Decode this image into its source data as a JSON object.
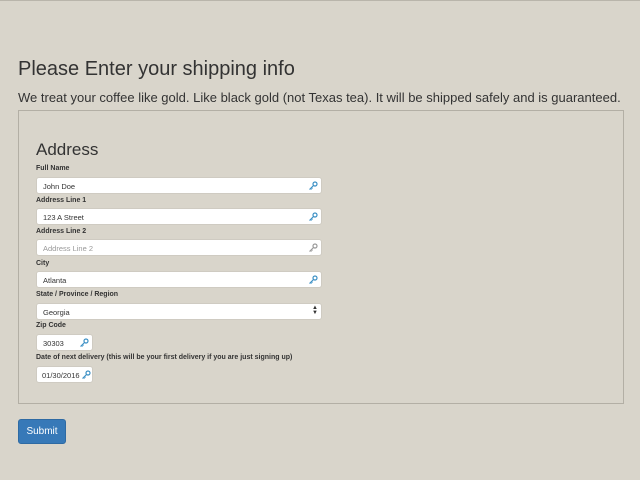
{
  "page": {
    "title": "Please Enter your shipping info",
    "intro": "We treat your coffee like gold. Like black gold (not Texas tea). It will be shipped safely and is guaranteed."
  },
  "address": {
    "section_title": "Address",
    "full_name": {
      "label": "Full Name",
      "value": "John Doe"
    },
    "address_line_1": {
      "label": "Address Line 1",
      "value": "123 A Street"
    },
    "address_line_2": {
      "label": "Address Line 2",
      "value": "",
      "placeholder": "Address Line 2"
    },
    "city": {
      "label": "City",
      "value": "Atlanta"
    },
    "state": {
      "label": "State / Province / Region",
      "selected": "Georgia"
    },
    "zip": {
      "label": "Zip Code",
      "value": "30303"
    },
    "delivery_date": {
      "label": "Date of next delivery (this will be your first delivery if you are just signing up)",
      "value": "01/30/2016"
    }
  },
  "actions": {
    "submit_label": "Submit"
  },
  "icons": {
    "autofill": "autofill-key-icon",
    "select": "chevron-updown-icon"
  },
  "colors": {
    "background": "#d9d5cb",
    "primary_button": "#3779b8",
    "icon": "#3a8fc4"
  }
}
